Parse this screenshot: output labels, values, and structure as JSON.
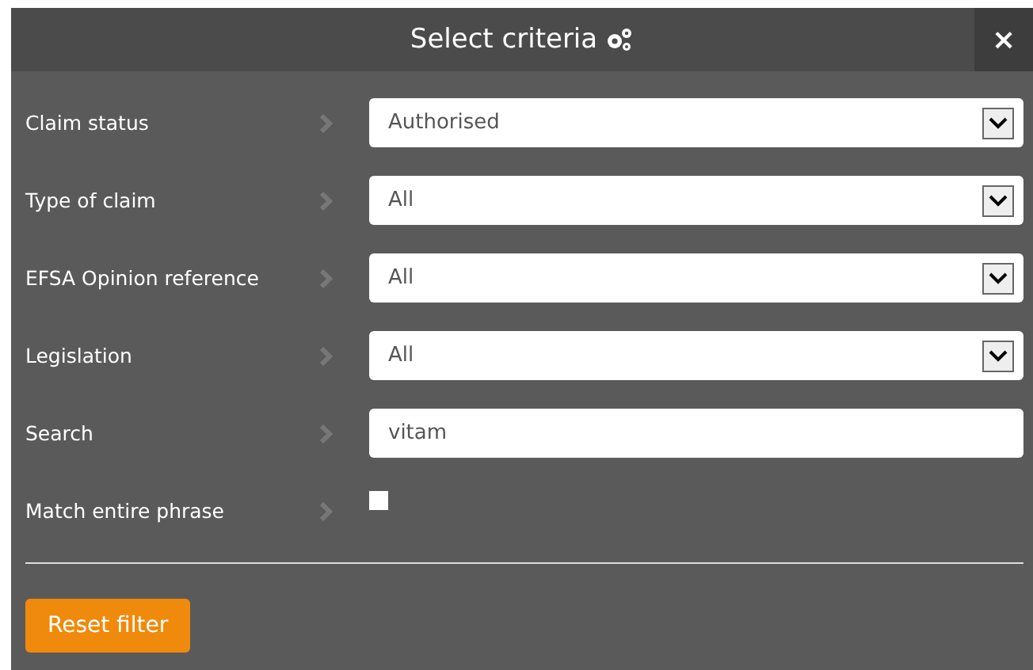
{
  "dialog": {
    "title": "Select criteria",
    "close": "×"
  },
  "criteria": [
    {
      "kind": "select",
      "label": "Claim status",
      "value": "Authorised"
    },
    {
      "kind": "select",
      "label": "Type of claim",
      "value": "All"
    },
    {
      "kind": "select",
      "label": "EFSA Opinion reference",
      "value": "All"
    },
    {
      "kind": "select",
      "label": "Legislation",
      "value": "All"
    },
    {
      "kind": "text",
      "label": "Search",
      "value": "vitam"
    },
    {
      "kind": "checkbox",
      "label": "Match entire phrase",
      "checked": false
    }
  ],
  "reset_button": "Reset filter"
}
